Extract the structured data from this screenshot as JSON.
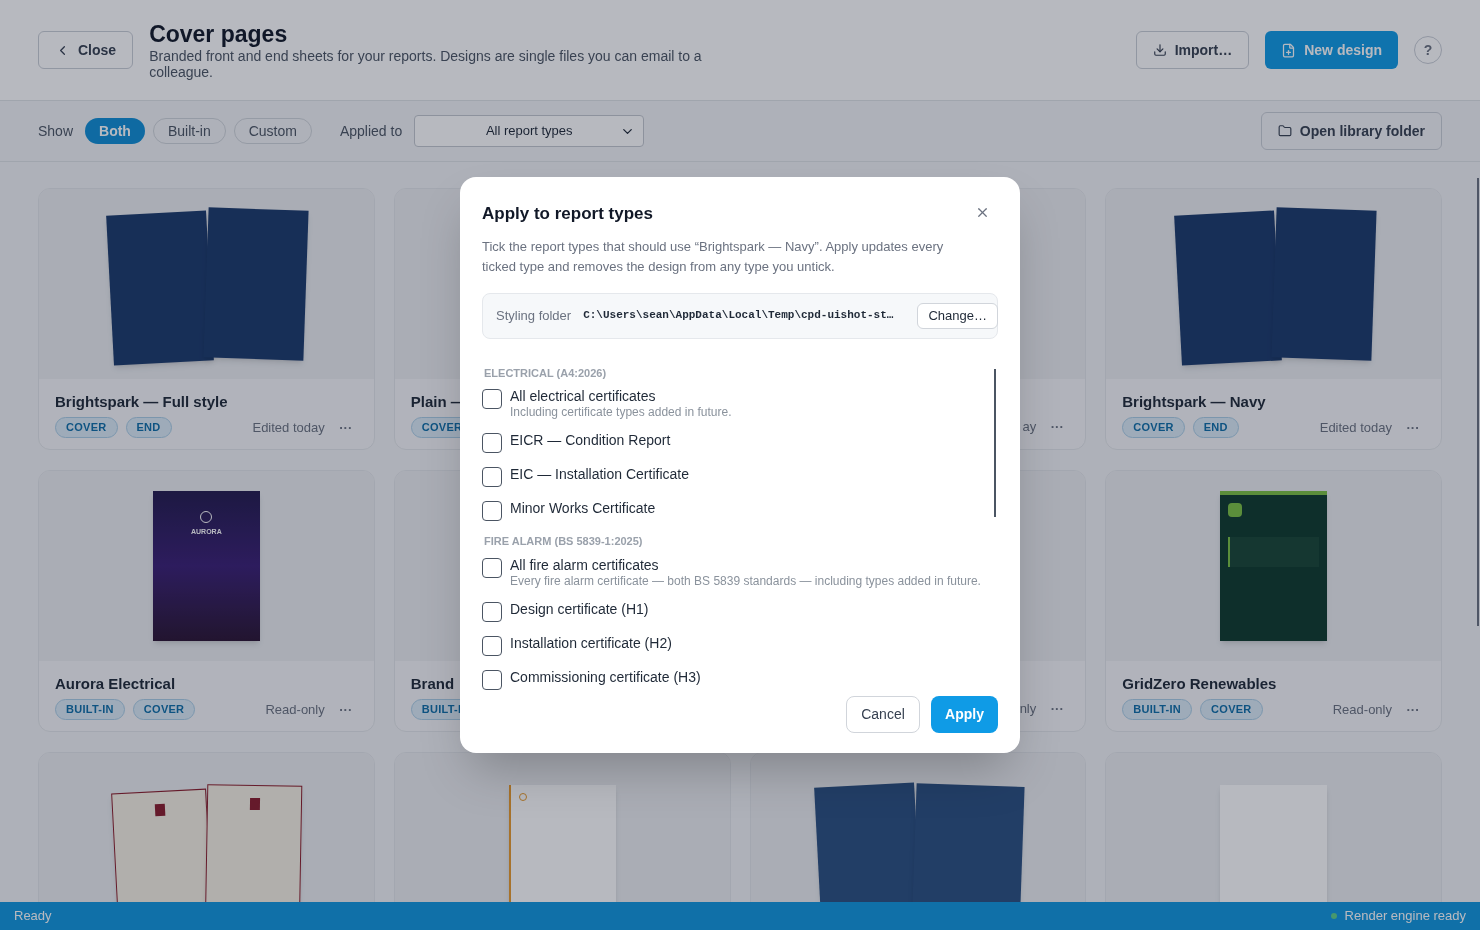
{
  "header": {
    "close": "Close",
    "title": "Cover pages",
    "subtitle": "Branded front and end sheets for your reports. Designs are single files you can email to a colleague.",
    "import": "Import…",
    "new_design": "New design",
    "help": "?"
  },
  "filters": {
    "show_label": "Show",
    "options": [
      {
        "label": "Both",
        "selected": true
      },
      {
        "label": "Built-in",
        "selected": false
      },
      {
        "label": "Custom",
        "selected": false
      }
    ],
    "applied_label": "Applied to",
    "applied_value": "All report types",
    "open_folder": "Open library folder"
  },
  "cards": [
    {
      "title": "Brightspark — Full style",
      "tags": [
        "COVER",
        "END"
      ],
      "meta": "Edited today",
      "more": "···",
      "preview": {
        "kind": "navy-pair"
      }
    },
    {
      "title": "Plain —",
      "tags": [
        "COVER"
      ]
    },
    {
      "meta": "ay",
      "more": "···"
    },
    {
      "title": "Brightspark — Navy",
      "tags": [
        "COVER",
        "END"
      ],
      "meta": "Edited today",
      "more": "···",
      "preview": {
        "kind": "navy-pair"
      }
    },
    {
      "title": "Aurora Electrical",
      "tags": [
        "BUILT-IN",
        "COVER"
      ],
      "meta": "Read-only",
      "more": "···",
      "preview": {
        "kind": "aurora",
        "texts": [
          "AURORA"
        ]
      }
    },
    {
      "title": "Brand",
      "tags": [
        "BUILT-I"
      ]
    },
    {
      "meta": "nly",
      "more": "···"
    },
    {
      "title": "GridZero Renewables",
      "tags": [
        "BUILT-IN",
        "COVER"
      ],
      "meta": "Read-only",
      "more": "···",
      "preview": {
        "kind": "gridzero"
      }
    },
    {
      "preview": {
        "kind": "heritage-pair"
      }
    },
    {
      "preview": {
        "kind": "lumen"
      }
    },
    {
      "preview": {
        "kind": "navy-circles"
      }
    },
    {
      "preview": {
        "kind": "plain"
      }
    }
  ],
  "dialog": {
    "title": "Apply to report types",
    "description": "Tick the report types that should use “Brightspark — Navy”. Apply updates every ticked type and removes the design from any type you untick.",
    "folder_label": "Styling folder",
    "folder_path": "C:\\Users\\sean\\AppData\\Local\\Temp\\cpd-uishot-st…",
    "change": "Change…",
    "groups": [
      {
        "heading": "ELECTRICAL (A4:2026)",
        "items": [
          {
            "label": "All electrical certificates",
            "note": "Including certificate types added in future.",
            "checked": false
          },
          {
            "label": "EICR — Condition Report",
            "checked": false
          },
          {
            "label": "EIC — Installation Certificate",
            "checked": false
          },
          {
            "label": "Minor Works Certificate",
            "checked": false
          }
        ]
      },
      {
        "heading": "FIRE ALARM (BS 5839-1:2025)",
        "items": [
          {
            "label": "All fire alarm certificates",
            "note": "Every fire alarm certificate — both BS 5839 standards — including types added in future.",
            "checked": false
          },
          {
            "label": "Design certificate (H1)",
            "checked": false
          },
          {
            "label": "Installation certificate (H2)",
            "checked": false
          },
          {
            "label": "Commissioning certificate (H3)",
            "checked": false
          }
        ]
      }
    ],
    "cancel": "Cancel",
    "apply": "Apply"
  },
  "status_bar": {
    "left": "Ready",
    "right": "Render engine ready"
  }
}
